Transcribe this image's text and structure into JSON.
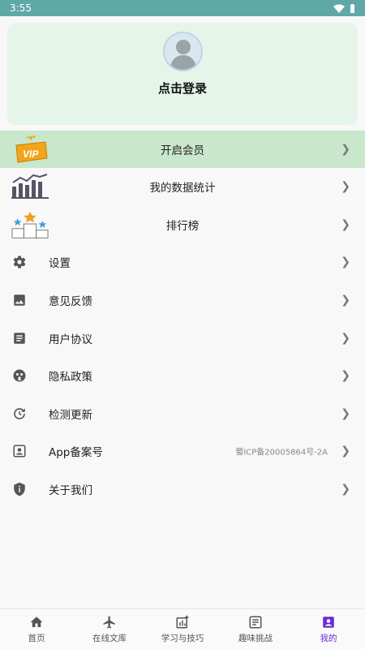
{
  "status": {
    "time": "3:55"
  },
  "profile": {
    "login_text": "点击登录"
  },
  "rows": [
    {
      "label": "开启会员",
      "icon": "vip-badge-icon"
    },
    {
      "label": "我的数据统计",
      "icon": "bar-chart-icon"
    },
    {
      "label": "排行榜",
      "icon": "podium-icon"
    },
    {
      "label": "设置",
      "icon": "gear-icon"
    },
    {
      "label": "意见反馈",
      "icon": "image-icon"
    },
    {
      "label": "用户协议",
      "icon": "document-icon"
    },
    {
      "label": "隐私政策",
      "icon": "privacy-icon"
    },
    {
      "label": "检测更新",
      "icon": "refresh-icon"
    },
    {
      "label": "App备案号",
      "icon": "id-card-icon",
      "value": "蜀ICP备20005864号-2A"
    },
    {
      "label": "关于我们",
      "icon": "info-shield-icon"
    }
  ],
  "vip_badge_text": "VIP",
  "nav": [
    {
      "label": "首页",
      "icon": "home-icon"
    },
    {
      "label": "在线文库",
      "icon": "airplane-icon"
    },
    {
      "label": "学习与技巧",
      "icon": "stats-plus-icon"
    },
    {
      "label": "趣味挑战",
      "icon": "list-doc-icon"
    },
    {
      "label": "我的",
      "icon": "profile-icon",
      "active": true
    }
  ],
  "colors": {
    "accent": "#6a2bd6",
    "vip_bg": "#c9e7cb",
    "card_bg": "#e6f5e9",
    "status_bar": "#5fa8a8"
  }
}
